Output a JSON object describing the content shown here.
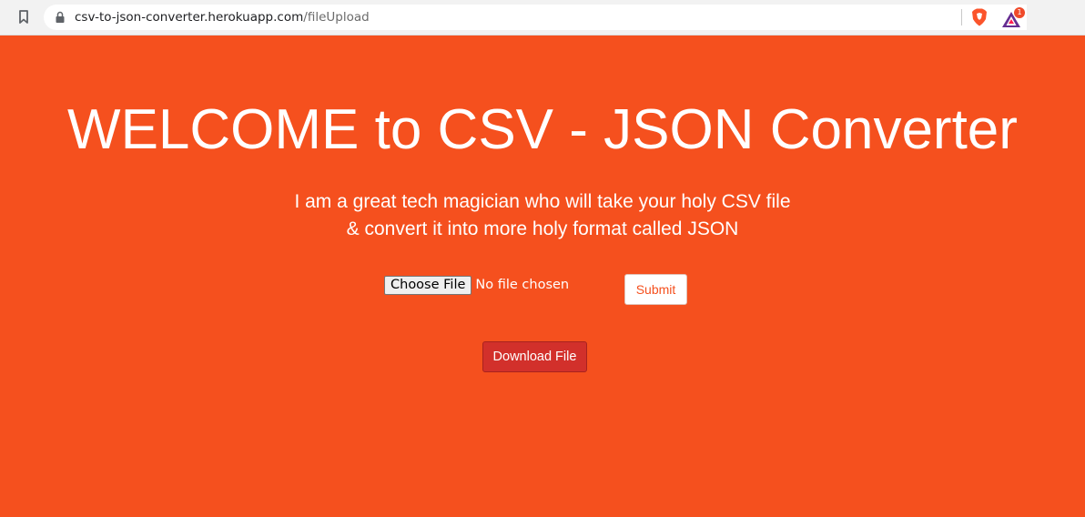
{
  "browser": {
    "url_host": "csv-to-json-converter.herokuapp.com",
    "url_path": "/fileUpload",
    "rewards_badge": "1"
  },
  "page": {
    "title": "WELCOME to CSV - JSON Converter",
    "subtitle_line1": "I am a great tech magician who will take your holy CSV file",
    "subtitle_line2": "& convert it into more holy format called JSON"
  },
  "upload": {
    "choose_file_label": "Choose File",
    "file_status": "No file chosen",
    "submit_label": "Submit"
  },
  "download": {
    "label": "Download File"
  },
  "colors": {
    "background": "#f5501e",
    "submit_text": "#f5501e",
    "download_button": "#d2302b",
    "text": "#ffffff"
  }
}
